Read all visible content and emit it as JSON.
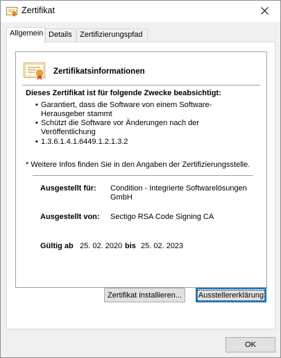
{
  "window": {
    "title": "Zertifikat",
    "close_symbol": "✕"
  },
  "tabs": [
    {
      "label": "Allgemein"
    },
    {
      "label": "Details"
    },
    {
      "label": "Zertifizierungspfad"
    }
  ],
  "general": {
    "heading": "Zertifikatsinformationen",
    "purpose_title": "Dieses Zertifikat ist für folgende Zwecke beabsichtigt:",
    "purposes": [
      "Garantiert, dass die Software von einem Software-Herausgeber stammt",
      "Schützt die Software vor Änderungen nach der Veröffentlichung",
      "1.3.6.1.4.1.6449.1.2.1.3.2"
    ],
    "note": "* Weitere Infos finden Sie in den Angaben der Zertifizierungsstelle.",
    "issued_to_label": "Ausgestellt für:",
    "issued_to_value": "Condition - Integrierte Softwarelösungen GmbH",
    "issued_by_label": "Ausgestellt von:",
    "issued_by_value": "Sectigo RSA Code Signing CA",
    "valid_from_label": "Gültig ab",
    "valid_from_value": "25. 02. 2020",
    "valid_to_label": "bis",
    "valid_to_value": "25. 02. 2023"
  },
  "buttons": {
    "install": "Zertifikat installieren...",
    "issuer_statement": "Ausstellererklärung",
    "ok": "OK"
  },
  "icons": {
    "title_icon": "certificate-icon",
    "cert_icon": "certificate-icon",
    "close_icon": "close-icon"
  },
  "colors": {
    "window_bg": "#f0f0f0",
    "panel_bg": "#ffffff",
    "button_bg": "#e1e1e1",
    "focus_border": "#0078d7",
    "cert_ribbon": "#f0a040"
  }
}
